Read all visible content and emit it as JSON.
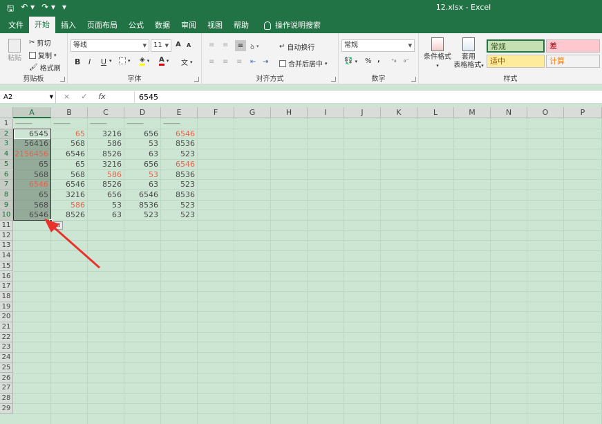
{
  "titlebar": {
    "title": "12.xlsx  -  Excel",
    "qat_icons": [
      "save-icon",
      "undo-icon",
      "redo-icon",
      "customize-icon"
    ]
  },
  "tabs": [
    "文件",
    "开始",
    "插入",
    "页面布局",
    "公式",
    "数据",
    "审阅",
    "视图",
    "帮助"
  ],
  "active_tab": "开始",
  "tell_me": "操作说明搜索",
  "ribbon": {
    "clipboard": {
      "paste": "粘贴",
      "cut": "剪切",
      "copy": "复制",
      "format_painter": "格式刷",
      "label": "剪贴板"
    },
    "font": {
      "name": "等线",
      "size": "11",
      "label": "字体",
      "bold": "B",
      "italic": "I",
      "underline": "U",
      "grow": "A",
      "shrink": "A"
    },
    "alignment": {
      "wrap": "自动换行",
      "merge": "合并后居中",
      "label": "对齐方式"
    },
    "number": {
      "format": "常规",
      "percent": "%",
      "comma": ",",
      "label": "数字"
    },
    "styles": {
      "conditional": "条件格式",
      "table_line1": "套用",
      "table_line2": "表格格式",
      "cells": [
        {
          "text": "常规",
          "bg": "#c6e0b4",
          "fg": "#375623"
        },
        {
          "text": "差",
          "bg": "#ffc7ce",
          "fg": "#9c0006"
        },
        {
          "text": "适中",
          "bg": "#ffeb9c",
          "fg": "#9c5700"
        },
        {
          "text": "计算",
          "bg": "#f2f2f2",
          "fg": "#fa7d00"
        }
      ],
      "label": "样式"
    }
  },
  "formula_bar": {
    "name_box": "A2",
    "cancel": "×",
    "enter": "✓",
    "fx": "fx",
    "value": "6545"
  },
  "columns": [
    "A",
    "B",
    "C",
    "D",
    "E",
    "F",
    "G",
    "H",
    "I",
    "J",
    "K",
    "L",
    "M",
    "N",
    "O",
    "P"
  ],
  "rows": [
    "1",
    "2",
    "3",
    "4",
    "5",
    "6",
    "7",
    "8",
    "9",
    "10",
    "11",
    "12",
    "13",
    "14",
    "15",
    "16",
    "17",
    "18",
    "19",
    "20",
    "21",
    "22",
    "23",
    "24",
    "25",
    "26",
    "27",
    "28",
    "29"
  ],
  "header_dashes": [
    "———",
    "———",
    "———",
    "———",
    "———"
  ],
  "cells": [
    [
      {
        "v": "6545",
        "red": false
      },
      {
        "v": "65",
        "red": true
      },
      {
        "v": "3216",
        "red": false
      },
      {
        "v": "656",
        "red": false
      },
      {
        "v": "6546",
        "red": true
      }
    ],
    [
      {
        "v": "56416",
        "red": false
      },
      {
        "v": "568",
        "red": false
      },
      {
        "v": "586",
        "red": false
      },
      {
        "v": "53",
        "red": false
      },
      {
        "v": "8536",
        "red": false
      }
    ],
    [
      {
        "v": "2156456",
        "red": true
      },
      {
        "v": "6546",
        "red": false
      },
      {
        "v": "8526",
        "red": false
      },
      {
        "v": "63",
        "red": false
      },
      {
        "v": "523",
        "red": false
      }
    ],
    [
      {
        "v": "65",
        "red": false
      },
      {
        "v": "65",
        "red": false
      },
      {
        "v": "3216",
        "red": false
      },
      {
        "v": "656",
        "red": false
      },
      {
        "v": "6546",
        "red": true
      }
    ],
    [
      {
        "v": "568",
        "red": false
      },
      {
        "v": "568",
        "red": false
      },
      {
        "v": "586",
        "red": true
      },
      {
        "v": "53",
        "red": true
      },
      {
        "v": "8536",
        "red": false
      }
    ],
    [
      {
        "v": "6546",
        "red": true
      },
      {
        "v": "6546",
        "red": false
      },
      {
        "v": "8526",
        "red": false
      },
      {
        "v": "63",
        "red": false
      },
      {
        "v": "523",
        "red": false
      }
    ],
    [
      {
        "v": "65",
        "red": false
      },
      {
        "v": "3216",
        "red": false
      },
      {
        "v": "656",
        "red": false
      },
      {
        "v": "6546",
        "red": false
      },
      {
        "v": "8536",
        "red": false
      }
    ],
    [
      {
        "v": "568",
        "red": false
      },
      {
        "v": "586",
        "red": true
      },
      {
        "v": "53",
        "red": false
      },
      {
        "v": "8536",
        "red": false
      },
      {
        "v": "523",
        "red": false
      }
    ],
    [
      {
        "v": "6546",
        "red": false
      },
      {
        "v": "8526",
        "red": false
      },
      {
        "v": "63",
        "red": false
      },
      {
        "v": "523",
        "red": false
      },
      {
        "v": "523",
        "red": false
      }
    ]
  ],
  "annotation": {
    "shape": "red-arrow",
    "color": "#e8322c"
  }
}
